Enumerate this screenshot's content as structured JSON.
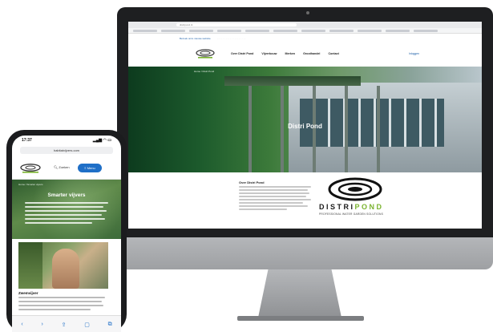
{
  "desktop": {
    "browser": {
      "url": "distripond.nl"
    },
    "site": {
      "top_link": "Bezoek onze nieuwe website",
      "nav": [
        "Over Distri Pond",
        "Vijverbouw",
        "Merken",
        "Groothandel",
        "Contact",
        "Inloggen"
      ],
      "breadcrumb": "Home / Distri Pond",
      "hero_title": "Distri Pond",
      "about_heading": "Over Distri Pond",
      "brand_name_part1": "DISTRI",
      "brand_name_part2": "POND",
      "brand_tagline": "PROFESSIONAL WATER GARDEN SOLUTIONS"
    }
  },
  "mobile": {
    "status": {
      "time": "17:37",
      "signal": "▂▄▆ ◠ ▭"
    },
    "url": "habitatvijvers.com",
    "search_label": "Zoeken",
    "menu_label": "≡ Menu",
    "breadcrumb": "Home / Smarter vijvers",
    "hero_title": "Smarter vijvers",
    "card_heading": "Zwemvijver",
    "toolbar": [
      "‹",
      "›",
      "⇪",
      "▢",
      "⧉"
    ]
  },
  "colors": {
    "accent_blue": "#1f6fc7",
    "brand_green": "#7ab32e",
    "bezel": "#1e1f21"
  }
}
